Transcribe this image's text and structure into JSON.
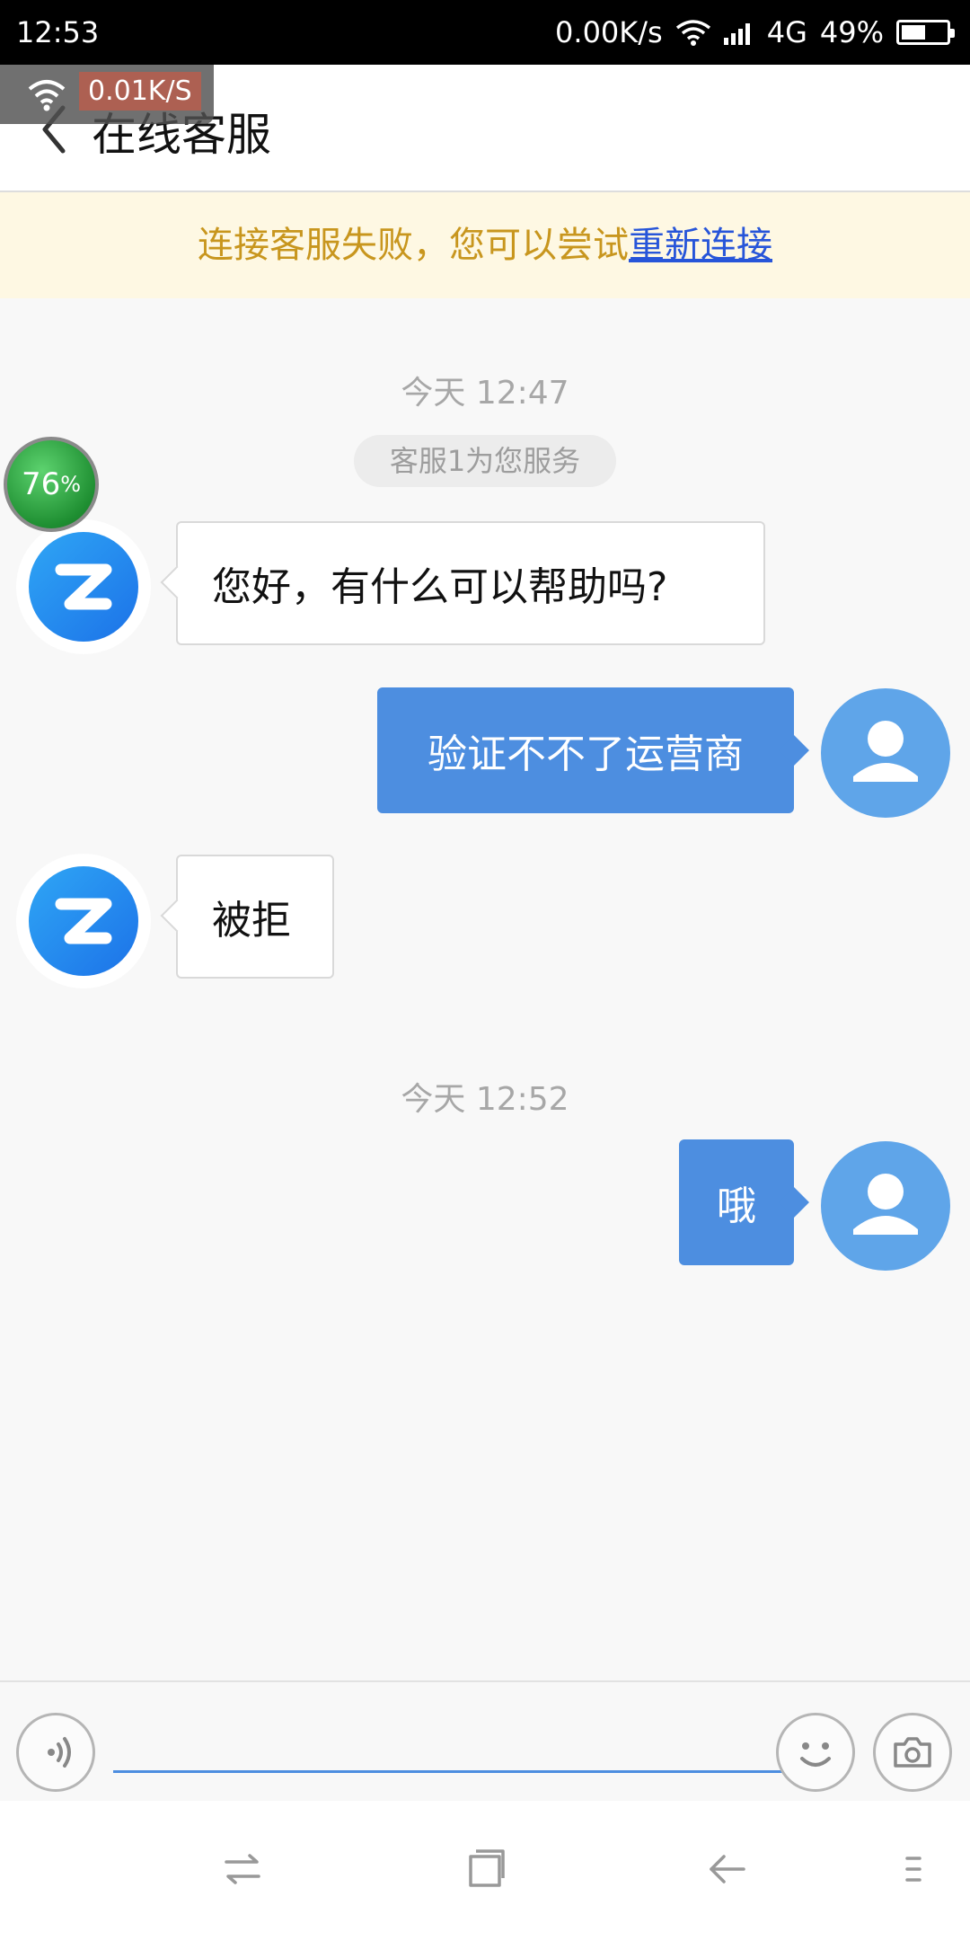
{
  "status_bar": {
    "time": "12:53",
    "net_speed": "0.00K/s",
    "network": "4G",
    "battery": "49%",
    "battery_level": 0.49
  },
  "overlay": {
    "speed": "0.01K/S",
    "progress": "76",
    "progress_unit": "%"
  },
  "header": {
    "title": "在线客服"
  },
  "banner": {
    "text": "连接客服失败，您可以尝试",
    "link": "重新连接"
  },
  "chat": {
    "timestamp_1": "今天 12:47",
    "service_notice": "客服1为您服务",
    "msg_agent_1": "您好，有什么可以帮助吗?",
    "msg_user_1": "验证不不了运营商",
    "msg_agent_2": "被拒",
    "timestamp_2": "今天 12:52",
    "msg_user_2": "哦"
  },
  "input": {
    "placeholder": ""
  },
  "colors": {
    "accent": "#4d8ee0",
    "banner_text": "#c8961e",
    "link": "#2755d9"
  },
  "icons": {
    "back": "chevron-left-icon",
    "voice": "voice-icon",
    "emoji": "smiley-icon",
    "camera": "camera-icon",
    "nav_switch": "switch-icon",
    "nav_home": "square-icon",
    "nav_back": "back-arrow-icon",
    "nav_menu": "menu-icon"
  }
}
